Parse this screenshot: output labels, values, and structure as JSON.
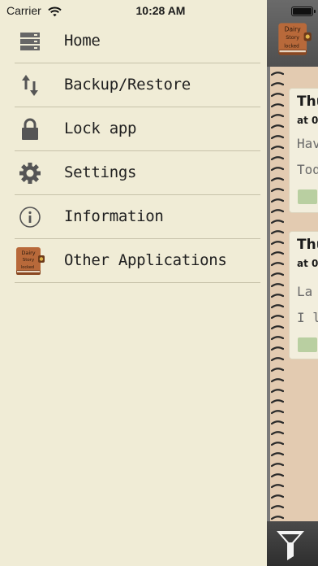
{
  "status_bar": {
    "carrier": "Carrier",
    "time": "10:28 AM"
  },
  "menu": {
    "items": [
      {
        "label": "Home",
        "icon": "server-stack-icon"
      },
      {
        "label": "Backup/Restore",
        "icon": "up-down-arrows-icon"
      },
      {
        "label": "Lock app",
        "icon": "padlock-icon"
      },
      {
        "label": "Settings",
        "icon": "gear-icon"
      },
      {
        "label": "Information",
        "icon": "info-circle-icon"
      },
      {
        "label": "Other Applications",
        "icon": "diary-book-icon"
      }
    ]
  },
  "diary_logo": {
    "line1": "Dairy",
    "line2": "Story",
    "line3": "locked"
  },
  "entries": [
    {
      "day": "Thu",
      "at": "at 0",
      "line1": "Hav",
      "line2": "Tod"
    },
    {
      "day": "Thu",
      "at": "at 0",
      "line1": "La",
      "line2": "I lo"
    }
  ],
  "colors": {
    "menu_background": "#f0ecd6",
    "notebook_paper": "#e3cbb1",
    "card": "#f2eedd",
    "folder": "#b9cfa1",
    "toolbar": "#555555"
  },
  "icons": {
    "wifi": "wifi-icon",
    "battery": "battery-icon",
    "filter": "filter-funnel-icon"
  }
}
